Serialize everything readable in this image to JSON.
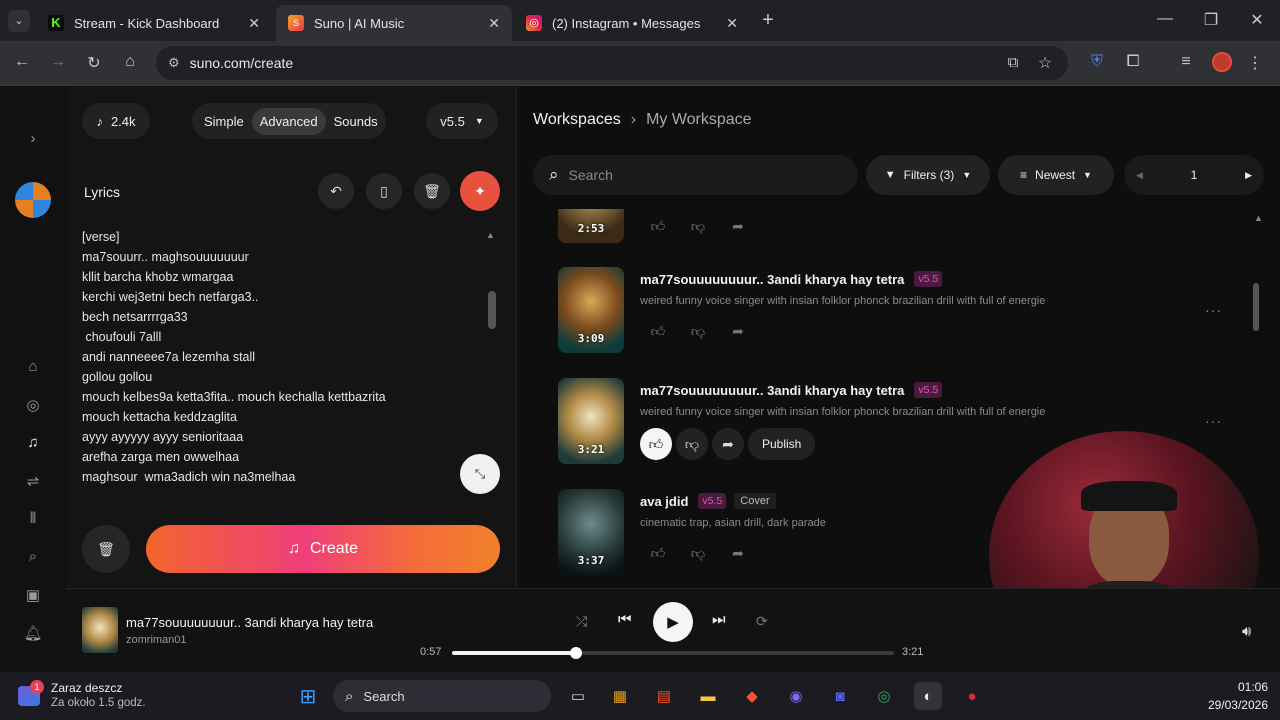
{
  "browser": {
    "tabs": [
      {
        "title": "Stream - Kick Dashboard",
        "color": "#53fc18",
        "glyph": "K"
      },
      {
        "title": "Suno | AI Music",
        "color": "#f56b3c",
        "glyph": "S"
      },
      {
        "title": "(2) Instagram • Messages",
        "color": "#d6249f",
        "glyph": "◎"
      }
    ],
    "url": "suno.com/create"
  },
  "create": {
    "credits": "2.4k",
    "modes": [
      "Simple",
      "Advanced",
      "Sounds"
    ],
    "active_mode": "Advanced",
    "version": "v5.5",
    "lyrics_label": "Lyrics",
    "lyrics": [
      "[verse]",
      "ma7souurr.. maghsouuuuuuur",
      "kllit barcha khobz wmargaa",
      "kerchi wej3etni bech netfarga3..",
      "bech netsarrrrga33",
      " choufouli 7alll",
      "andi nanneeee7a lezemha stall",
      "gollou gollou",
      "mouch kelbes9a ketta3fita.. mouch kechalla kettbazrita",
      "mouch kettacha keddzaglita",
      "ayyy ayyyyy ayyy senioritaaa",
      "arefha zarga men owwelhaa",
      "maghsour  wma3adich win na3melhaa"
    ],
    "create_label": "Create"
  },
  "workspace": {
    "breadcrumb_root": "Workspaces",
    "breadcrumb_current": "My Workspace",
    "search_placeholder": "Search",
    "filters_label": "Filters (3)",
    "sort_label": "Newest",
    "page": "1",
    "songs": [
      {
        "duration": "2:53"
      },
      {
        "duration": "3:09",
        "title": "ma77souuuuuuuur.. 3andi kharya hay tetra",
        "version": "v5.5",
        "desc": "weired funny voice singer with insian folklor phonck brazilian drill with full of energie"
      },
      {
        "duration": "3:21",
        "title": "ma77souuuuuuuur.. 3andi kharya hay tetra",
        "version": "v5.5",
        "desc": "weired funny voice singer with insian folklor phonck brazilian drill with full of energie",
        "publish": "Publish"
      },
      {
        "duration": "3:37",
        "title": "ava jdid",
        "version": "v5.5",
        "tag": "Cover",
        "desc": "cinematic trap, asian drill, dark parade"
      }
    ]
  },
  "player": {
    "title": "ma77souuuuuuuur.. 3andi kharya hay tetra",
    "artist": "zomriman01",
    "elapsed": "0:57",
    "total": "3:21",
    "progress": 0.28
  },
  "taskbar": {
    "notif_title": "Zaraz deszcz",
    "notif_sub": "Za około 1.5 godz.",
    "search": "Search",
    "time": "01:06",
    "date": "29/03/2026"
  }
}
